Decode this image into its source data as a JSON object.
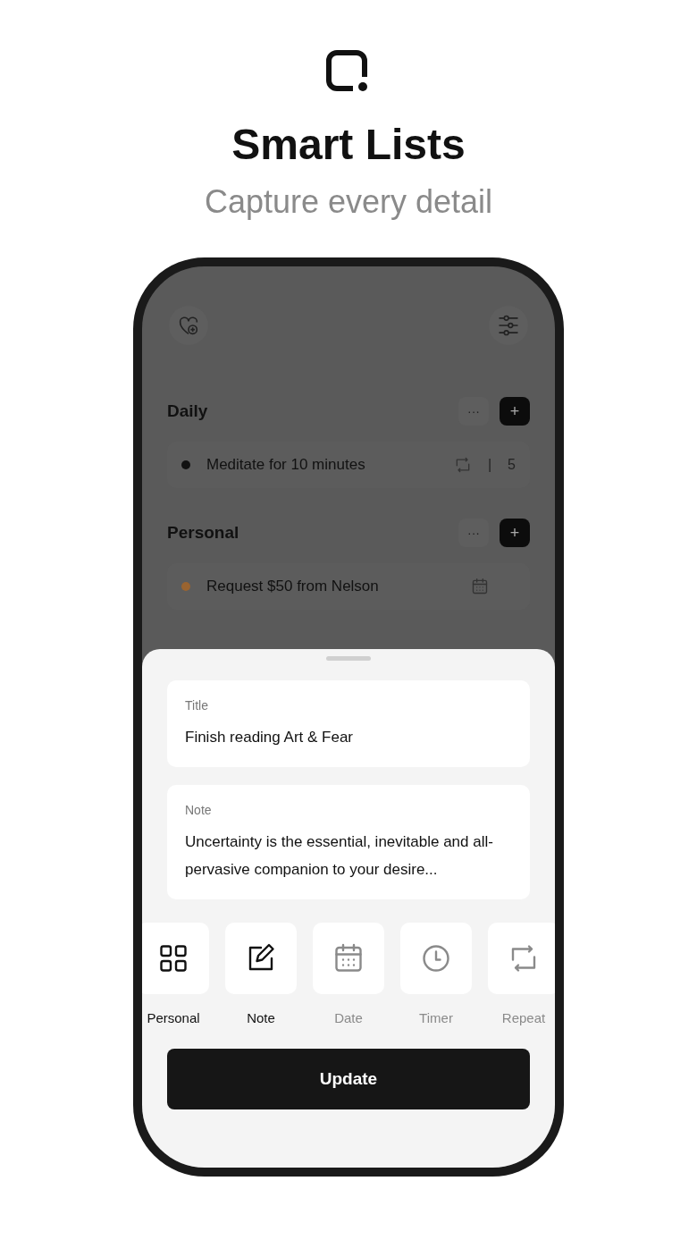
{
  "headline": {
    "title": "Smart Lists",
    "subtitle": "Capture every detail"
  },
  "lists": [
    {
      "name": "Daily",
      "more": "···",
      "add": "+",
      "tasks": [
        {
          "title": "Meditate for 10 minutes",
          "color": "#111111",
          "kind": "repeat",
          "count": "5",
          "separator": "|"
        }
      ]
    },
    {
      "name": "Personal",
      "more": "···",
      "add": "+",
      "tasks": [
        {
          "title": "Request $50 from Nelson",
          "color": "#9a6430",
          "kind": "date"
        }
      ]
    }
  ],
  "sheet": {
    "fields": [
      {
        "label": "Title",
        "value": "Finish reading Art & Fear"
      },
      {
        "label": "Note",
        "value": "Uncertainty is the essential, inevitable and all-pervasive companion to your desire..."
      }
    ],
    "tools": [
      {
        "kind": "list",
        "label": "Personal",
        "active": true
      },
      {
        "kind": "note",
        "label": "Note",
        "active": true
      },
      {
        "kind": "date",
        "label": "Date",
        "active": false
      },
      {
        "kind": "timer",
        "label": "Timer",
        "active": false
      },
      {
        "kind": "repeat",
        "label": "Repeat",
        "active": false
      }
    ],
    "button": "Update"
  }
}
